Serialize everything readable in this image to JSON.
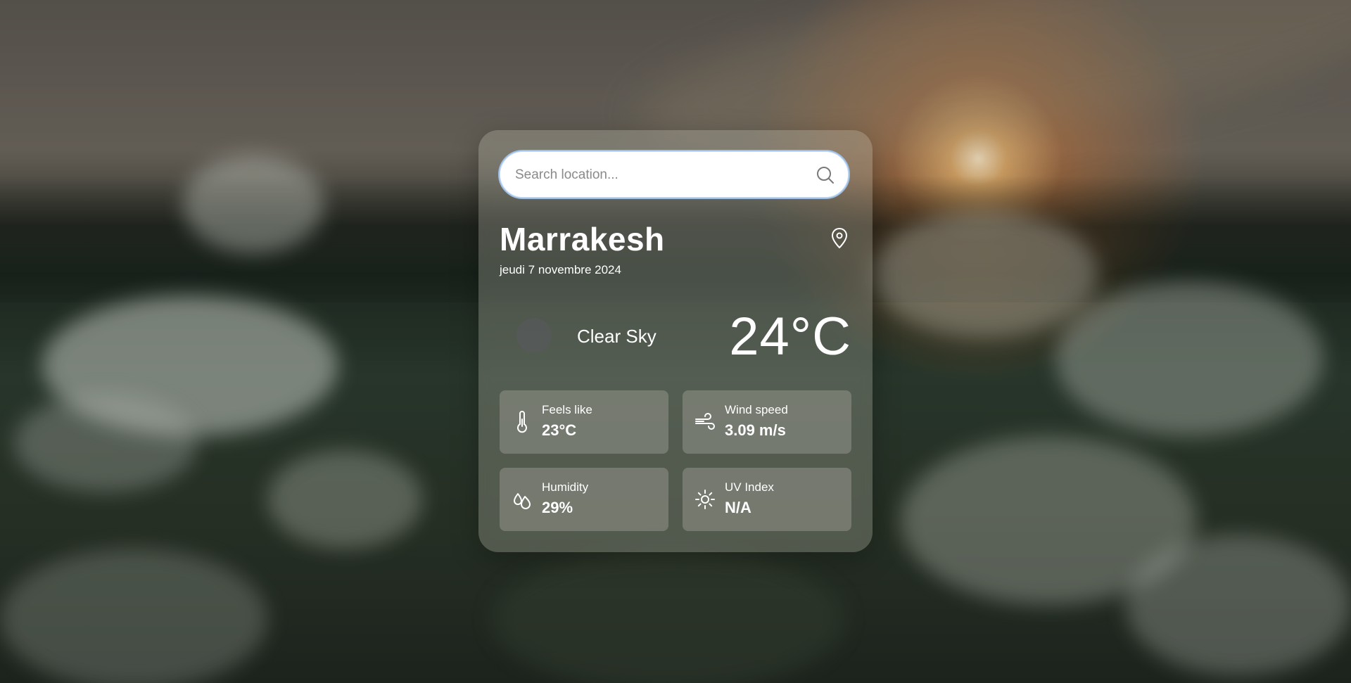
{
  "search": {
    "placeholder": "Search location...",
    "value": ""
  },
  "location": {
    "city": "Marrakesh",
    "date": "jeudi 7 novembre 2024"
  },
  "current": {
    "condition": "Clear Sky",
    "temperature": "24°C"
  },
  "details": {
    "feels_like": {
      "label": "Feels like",
      "value": "23°C",
      "icon": "thermometer-icon"
    },
    "wind_speed": {
      "label": "Wind speed",
      "value": "3.09 m/s",
      "icon": "wind-icon"
    },
    "humidity": {
      "label": "Humidity",
      "value": "29%",
      "icon": "droplets-icon"
    },
    "uv_index": {
      "label": "UV Index",
      "value": "N/A",
      "icon": "sun-icon"
    }
  },
  "colors": {
    "card_bg": "#bebeaf",
    "search_border": "#9ebfe6",
    "text": "#ffffff"
  }
}
